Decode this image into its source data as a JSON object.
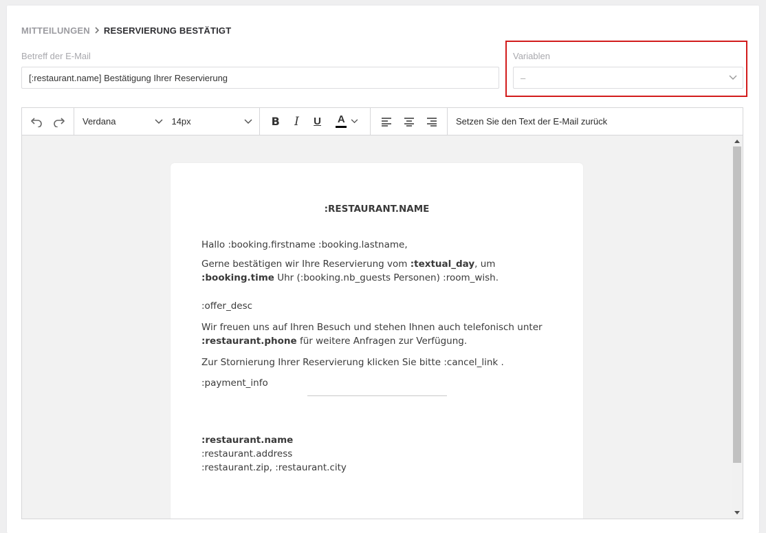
{
  "breadcrumb": {
    "parent": "MITTEILUNGEN",
    "current": "RESERVIERUNG BESTÄTIGT"
  },
  "subject": {
    "label": "Betreff der E-Mail",
    "value": "[:restaurant.name] Bestätigung Ihrer Reservierung"
  },
  "variables": {
    "label": "Variablen",
    "selected": "–"
  },
  "toolbar": {
    "font_family": "Verdana",
    "font_size": "14px",
    "reset_label": "Setzen Sie den Text der E-Mail zurück",
    "text_color": "#000000"
  },
  "mail": {
    "title": ":RESTAURANT.NAME",
    "greeting": "Hallo :booking.firstname :booking.lastname,",
    "confirm_1": "Gerne bestätigen wir Ihre Reservierung vom ",
    "confirm_day": ":textual_day",
    "confirm_2": ", um",
    "confirm_time": ":booking.time",
    "confirm_3": " Uhr (:booking.nb_guests Personen) :room_wish.",
    "offer": ":offer_desc",
    "visit_1": "Wir freuen uns auf Ihren Besuch und stehen Ihnen auch telefonisch unter ",
    "visit_phone": ":restaurant.phone",
    "visit_2": " für weitere Anfragen zur Verfügung.",
    "cancel": "Zur Stornierung Ihrer Reservierung klicken Sie bitte :cancel_link .",
    "payment": ":payment_info",
    "footer_name": ":restaurant.name",
    "footer_address": ":restaurant.address",
    "footer_city": ":restaurant.zip, :restaurant.city"
  }
}
